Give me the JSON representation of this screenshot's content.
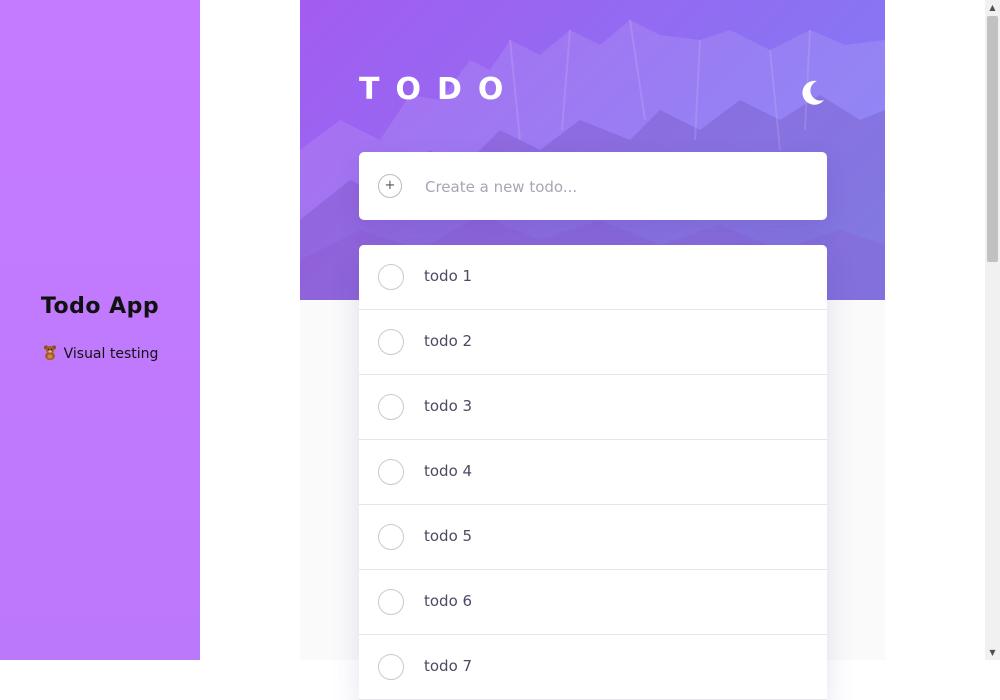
{
  "sidebar": {
    "title": "Todo App",
    "subtitle": "Visual testing",
    "subtitle_icon": "teddy-bear-icon"
  },
  "header": {
    "title": "TODO",
    "theme_toggle_icon": "moon-icon"
  },
  "new_todo": {
    "placeholder": "Create a new todo...",
    "value": "",
    "add_icon": "plus-icon",
    "add_symbol": "+"
  },
  "todos": [
    {
      "label": "todo 1",
      "completed": false
    },
    {
      "label": "todo 2",
      "completed": false
    },
    {
      "label": "todo 3",
      "completed": false
    },
    {
      "label": "todo 4",
      "completed": false
    },
    {
      "label": "todo 5",
      "completed": false
    },
    {
      "label": "todo 6",
      "completed": false
    },
    {
      "label": "todo 7",
      "completed": false
    }
  ],
  "colors": {
    "sidebar_bg": "#c57bff",
    "hero_start": "#a35cf0",
    "hero_end": "#7f80f5",
    "text_dark": "#4a4b63",
    "placeholder": "#a6a6b5"
  }
}
